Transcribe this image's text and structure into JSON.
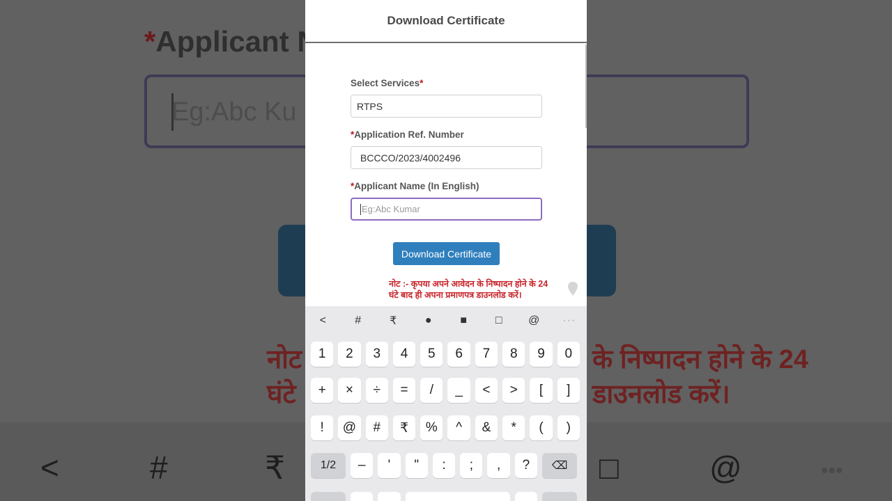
{
  "background": {
    "label": "Applicant N",
    "input_placeholder": "Eg:Abc Ku",
    "note_left": "नोट",
    "note_left2": "घंटे",
    "note_right": "के निष्पादन होने के 24",
    "note_right2": "डाउनलोड करें।",
    "toolbar": [
      "<",
      "#",
      "₹",
      "□",
      "@",
      "•••"
    ]
  },
  "header": {
    "title": "Download Certificate"
  },
  "form": {
    "services_label": "Select Services",
    "services_value": "RTPS",
    "ref_label": "Application Ref. Number",
    "ref_value": "BCCCO/2023/4002496",
    "name_label": "Applicant Name (In English)",
    "name_placeholder": "Eg:Abc Kumar",
    "required_mark": "*",
    "submit_label": "Download Certificate"
  },
  "note": {
    "line1": "नोट :- कृपया अपने आवेदन के निष्पादन होने के 24",
    "line2": "घंटे बाद ही अपना प्रमाणपत्र डाउनलोड करें।"
  },
  "keyboard": {
    "toolbar": [
      "<",
      "#",
      "₹",
      "●",
      "■",
      "□",
      "@",
      "···"
    ],
    "row1": [
      "1",
      "2",
      "3",
      "4",
      "5",
      "6",
      "7",
      "8",
      "9",
      "0"
    ],
    "row2": [
      "+",
      "×",
      "÷",
      "=",
      "/",
      "_",
      "<",
      ">",
      "[",
      "]"
    ],
    "row3": [
      "!",
      "@",
      "#",
      "₹",
      "%",
      "^",
      "&",
      "*",
      "(",
      ")"
    ],
    "row4": [
      "1/2",
      "–",
      "'",
      "\"",
      ":",
      ";",
      ",",
      "?",
      "⌫"
    ]
  },
  "colors": {
    "accent": "#2f7fbd",
    "required": "#c0171b",
    "note": "#c9262c",
    "focus": "#8d6bc0"
  }
}
